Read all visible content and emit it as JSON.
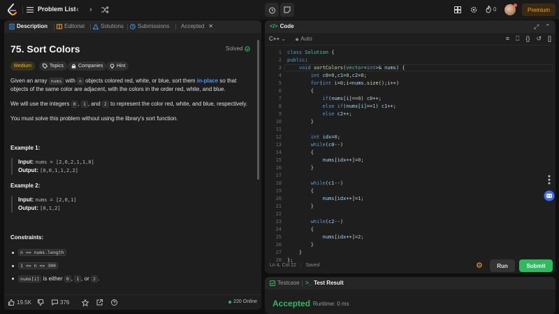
{
  "topbar": {
    "problem_list_label": "Problem List",
    "streak_count": "0",
    "premium_label": "Premium"
  },
  "description_panel": {
    "tabs": [
      {
        "label": "Description"
      },
      {
        "label": "Editorial"
      },
      {
        "label": "Solutions"
      },
      {
        "label": "Submissions"
      },
      {
        "label": "Accepted"
      }
    ],
    "title": "75. Sort Colors",
    "solved_label": "Solved",
    "chips": {
      "difficulty": "Medium",
      "topics": "Topics",
      "companies": "Companies",
      "hint": "Hint"
    },
    "paragraph1": {
      "t1": "Given an array ",
      "code1": "nums",
      "t2": " with ",
      "code2": "n",
      "t3": " objects colored red, white, or blue, sort them ",
      "link": "in-place",
      "t4": " so that objects of the same color are adjacent, with the colors in the order red, white, and blue."
    },
    "paragraph2": {
      "t1": "We will use the integers ",
      "c0": "0",
      "t2": ", ",
      "c1": "1",
      "t3": ", and ",
      "c2": "2",
      "t4": " to represent the color red, white, and blue, respectively."
    },
    "paragraph3": "You must solve this problem without using the library's sort function.",
    "examples": [
      {
        "title": "Example 1:",
        "input_label": "Input:",
        "input": "nums = [2,0,2,1,1,0]",
        "output_label": "Output:",
        "output": "[0,0,1,1,2,2]"
      },
      {
        "title": "Example 2:",
        "input_label": "Input:",
        "input": "nums = [2,0,1]",
        "output_label": "Output:",
        "output": "[0,1,2]"
      }
    ],
    "constraints_title": "Constraints:",
    "constraints": {
      "c1": "n == nums.length",
      "c2": "1 <= n <= 300",
      "c3_code": "nums[i]",
      "c3_t1": " is either ",
      "c3_a": "0",
      "c3_t2": ", ",
      "c3_b": "1",
      "c3_t3": ", or ",
      "c3_c": "2",
      "c3_t4": "."
    },
    "bottom": {
      "likes": "19.5K",
      "comments": "376",
      "online": "220 Online"
    }
  },
  "code_panel": {
    "tab_label": "Code",
    "language": "C++",
    "auto_label": "Auto",
    "status_position": "Ln 4, Col 22",
    "status_saved": "Saved",
    "run_label": "Run",
    "submit_label": "Submit",
    "line_numbers": [
      "1",
      "2",
      "3",
      "4",
      "5",
      "6",
      "7",
      "8",
      "9",
      "10",
      "11",
      "12",
      "13",
      "14",
      "15",
      "16",
      "17",
      "18",
      "19",
      "20",
      "21",
      "22",
      "23",
      "24",
      "25",
      "26",
      "27",
      "28"
    ]
  },
  "test_panel": {
    "testcase_tab": "Testcase",
    "result_tab": "Test Result",
    "verdict": "Accepted",
    "runtime": "Runtime: 0 ms"
  },
  "colors": {
    "accent_orange": "#ffa116",
    "accepted_green": "#2cbb5d",
    "link_blue": "#3f9bf6",
    "medium_yellow": "#ffb800"
  }
}
